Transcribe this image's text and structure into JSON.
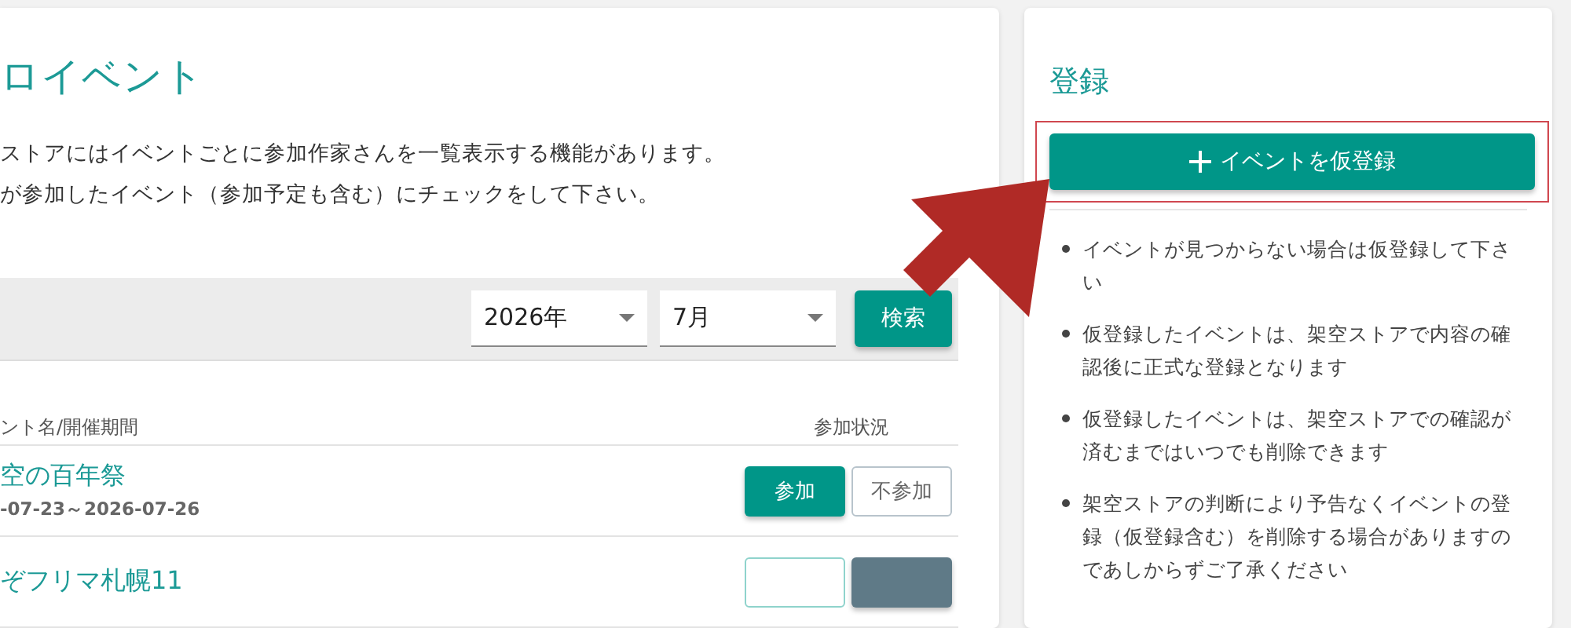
{
  "main": {
    "title": "ロイベント",
    "intro": [
      "ストアにはイベントごとに参加作家さんを一覧表示する機能があります。",
      "が参加したイベント（参加予定も含む）にチェックをして下さい。"
    ],
    "filters": [
      {
        "value": "2026年"
      },
      {
        "value": "7月"
      }
    ],
    "search_button": "検索",
    "table": {
      "columns": [
        "ント名/開催期間",
        "参加状況"
      ],
      "rows": [
        {
          "title": "空の百年祭",
          "dates": "-07-23～2026-07-26",
          "options": [
            {
              "kind": "attend",
              "label": "参加",
              "selected": true
            },
            {
              "kind": "absent",
              "label": "不参加",
              "selected": false
            }
          ]
        },
        {
          "title": "ぞフリマ札幌11",
          "options": [
            {
              "kind": "attend",
              "selected": false
            },
            {
              "kind": "absent",
              "selected": true
            }
          ]
        }
      ]
    }
  },
  "sidebar": {
    "title": "登録",
    "register_button": "イベントを仮登録",
    "highlighted": true,
    "notes": [
      "イベントが見つからない場合は仮登録して下さい",
      "仮登録したイベントは、架空ストアで内容の確認後に正式な登録となります",
      "仮登録したイベントは、架空ストアでの確認が済むまではいつでも削除できます",
      "架空ストアの判断により予告なくイベントの登録（仮登録含む）を削除する場合がありますのであしからずご了承ください"
    ]
  }
}
